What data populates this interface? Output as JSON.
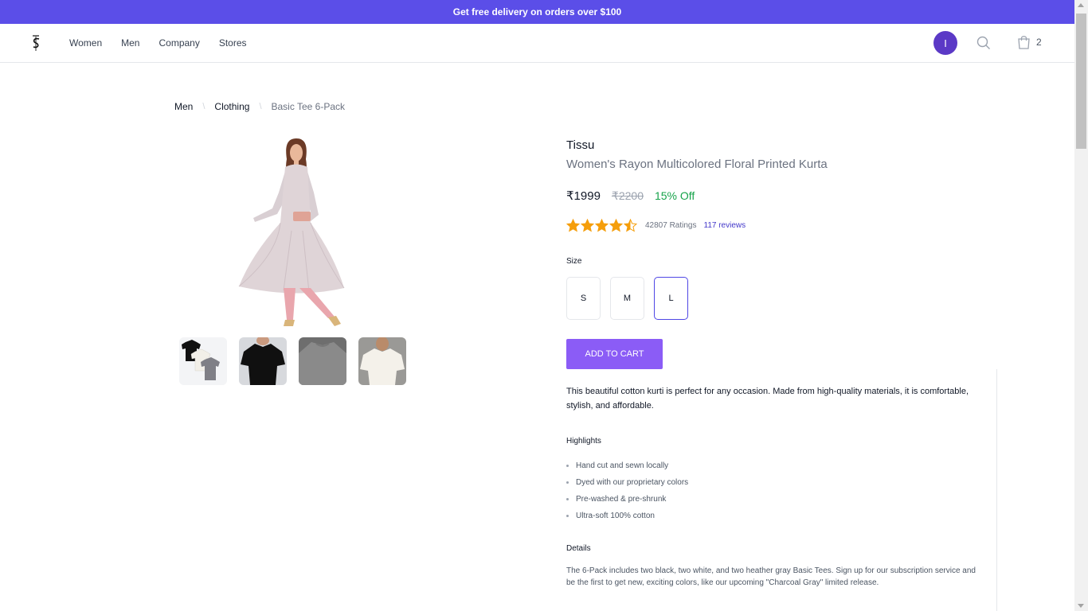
{
  "promo": {
    "text": "Get free delivery on orders over $100"
  },
  "nav": {
    "links": [
      "Women",
      "Men",
      "Company",
      "Stores"
    ],
    "avatar_initial": "I",
    "cart_count": "2"
  },
  "breadcrumb": {
    "items": [
      "Men",
      "Clothing"
    ],
    "current": "Basic Tee 6-Pack"
  },
  "product": {
    "brand": "Tissu",
    "title": "Women's Rayon Multicolored Floral Printed Kurta",
    "price": "₹1999",
    "mrp": "₹2200",
    "discount": "15% Off",
    "rating": 4.5,
    "ratings_count": "42807 Ratings",
    "reviews": "117 reviews",
    "size_label": "Size",
    "sizes": [
      "S",
      "M",
      "L"
    ],
    "selected_size": "L",
    "add_to_cart": "ADD TO CART",
    "description": "This beautiful cotton kurti is perfect for any occasion. Made from high-quality materials, it is comfortable, stylish, and affordable.",
    "highlights_title": "Highlights",
    "highlights": [
      "Hand cut and sewn locally",
      "Dyed with our proprietary colors",
      "Pre-washed & pre-shrunk",
      "Ultra-soft 100% cotton"
    ],
    "details_title": "Details",
    "details": "The 6-Pack includes two black, two white, and two heather gray Basic Tees. Sign up for our subscription service and be the first to get new, exciting colors, like our upcoming \"Charcoal Gray\" limited release."
  },
  "colors": {
    "accent": "#5b4ee8",
    "button": "#8b5cf6",
    "avatar": "#5b39c6",
    "star": "#f59e0b",
    "discount": "#16a34a",
    "link": "#4338ca"
  }
}
